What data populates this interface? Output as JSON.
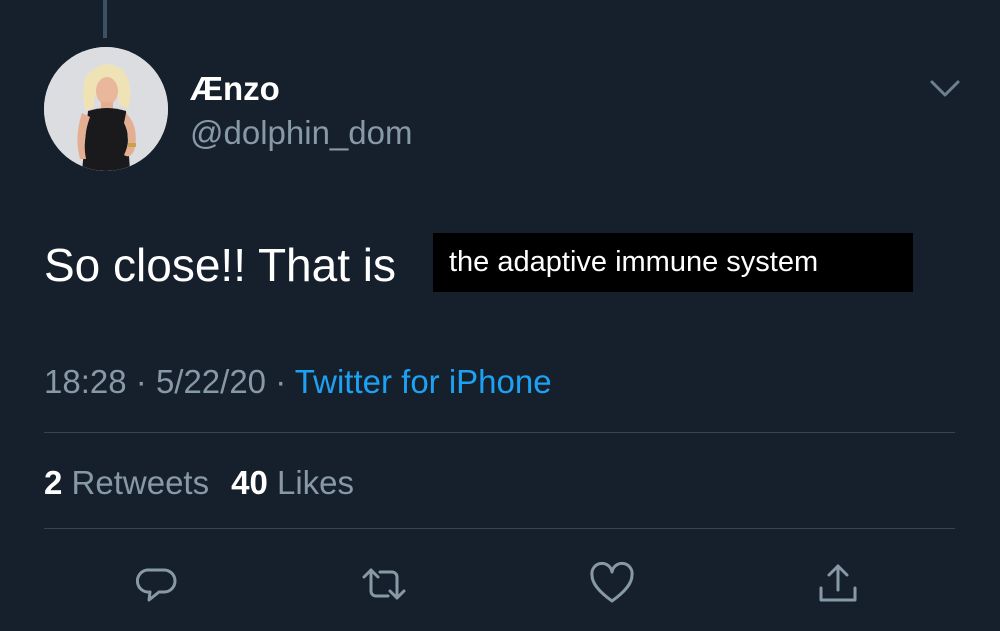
{
  "user": {
    "display_name": "Ænzo",
    "handle": "@dolphin_dom"
  },
  "tweet": {
    "text_prefix": "So close!! That is",
    "redacted_caption": "the adaptive immune system"
  },
  "meta": {
    "time": "18:28",
    "separator": "·",
    "date": "5/22/20",
    "source": "Twitter for iPhone"
  },
  "stats": {
    "retweets_count": "2",
    "retweets_label": "Retweets",
    "likes_count": "40",
    "likes_label": "Likes"
  },
  "icons": {
    "caret": "chevron-down-icon",
    "reply": "reply-icon",
    "retweet": "retweet-icon",
    "like": "heart-icon",
    "share": "share-icon"
  },
  "colors": {
    "background": "#161f2c",
    "text_primary": "#ffffff",
    "text_secondary": "#8899a6",
    "accent": "#1da1f2",
    "divider": "#38444d"
  }
}
